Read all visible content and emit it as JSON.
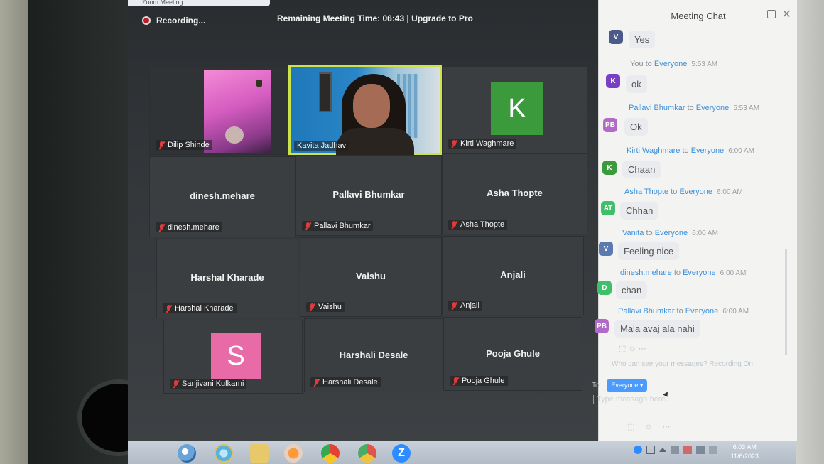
{
  "window": {
    "title": "Zoom Meeting",
    "recording_label": "Recording...",
    "timer_text": "Remaining Meeting Time: 06:43 | Upgrade to Pro"
  },
  "tiles": [
    {
      "name": "Dilip Shinde",
      "center_label": ""
    },
    {
      "name": "Kavita Jadhav",
      "center_label": ""
    },
    {
      "name": "Kirti Waghmare",
      "center_label": "",
      "avatar_letter": "K",
      "avatar_color": "#3b9a3b"
    },
    {
      "name": "dinesh.mehare",
      "center_label": "dinesh.mehare"
    },
    {
      "name": "Pallavi Bhumkar",
      "center_label": "Pallavi Bhumkar"
    },
    {
      "name": "Asha Thopte",
      "center_label": "Asha Thopte"
    },
    {
      "name": "Harshal Kharade",
      "center_label": "Harshal Kharade"
    },
    {
      "name": "Vaishu",
      "center_label": "Vaishu"
    },
    {
      "name": "Anjali",
      "center_label": "Anjali"
    },
    {
      "name": "Sanjivani Kulkarni",
      "center_label": "",
      "avatar_letter": "S",
      "avatar_color": "#e86aa6"
    },
    {
      "name": "Harshali Desale",
      "center_label": "Harshali Desale"
    },
    {
      "name": "Pooja Ghule",
      "center_label": "Pooja Ghule"
    }
  ],
  "chat": {
    "title": "Meeting Chat",
    "messages": [
      {
        "sender": "",
        "to": "",
        "recipient": "",
        "time": "",
        "avatar": "V",
        "avatar_color": "#4a5a8a",
        "text": "Yes"
      },
      {
        "sender": "You",
        "to": "to",
        "recipient": "Everyone",
        "time": "5:53 AM",
        "avatar": "K",
        "avatar_color": "#7a3fc7",
        "text": "ok"
      },
      {
        "sender": "Pallavi Bhumkar",
        "to": "to",
        "recipient": "Everyone",
        "time": "5:53 AM",
        "avatar": "PB",
        "avatar_color": "#b26ac7",
        "text": "Ok"
      },
      {
        "sender": "Kirti Waghmare",
        "to": "to",
        "recipient": "Everyone",
        "time": "6:00 AM",
        "avatar": "K",
        "avatar_color": "#3b9a3b",
        "text": "Chaan"
      },
      {
        "sender": "Asha Thopte",
        "to": "to",
        "recipient": "Everyone",
        "time": "6:00 AM",
        "avatar": "AT",
        "avatar_color": "#3fbf6a",
        "text": "Chhan"
      },
      {
        "sender": "Vanita",
        "to": "to",
        "recipient": "Everyone",
        "time": "6:00 AM",
        "avatar": "V",
        "avatar_color": "#5a7ab0",
        "text": "Feeling nice"
      },
      {
        "sender": "dinesh.mehare",
        "to": "to",
        "recipient": "Everyone",
        "time": "6:00 AM",
        "avatar": "D",
        "avatar_color": "#3fbf6a",
        "text": "chan"
      },
      {
        "sender": "Pallavi Bhumkar",
        "to": "to",
        "recipient": "Everyone",
        "time": "6:00 AM",
        "avatar": "PB",
        "avatar_color": "#b26ac7",
        "text": "Mala avaj ala nahi"
      }
    ],
    "who_can_see": "Who can see your messages? Recording On",
    "to_label": "To:",
    "to_value": "Everyone",
    "input_placeholder": "Type message here..."
  },
  "taskbar": {
    "zoom_letter": "Z",
    "clock_time": "6:03 AM",
    "clock_date": "11/6/2023"
  }
}
